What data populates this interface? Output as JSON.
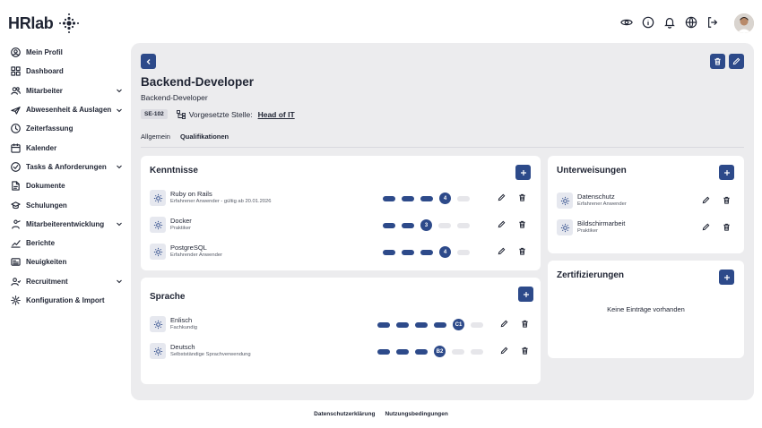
{
  "app": {
    "logo_text": "HRlab"
  },
  "sidebar": {
    "items": [
      {
        "label": "Mein Profil",
        "icon": "user-circle-icon",
        "chevron": false
      },
      {
        "label": "Dashboard",
        "icon": "grid-icon",
        "chevron": false
      },
      {
        "label": "Mitarbeiter",
        "icon": "users-icon",
        "chevron": true
      },
      {
        "label": "Abwesenheit & Auslagen",
        "icon": "plane-icon",
        "chevron": true
      },
      {
        "label": "Zeiterfassung",
        "icon": "clock-icon",
        "chevron": false
      },
      {
        "label": "Kalender",
        "icon": "calendar-icon",
        "chevron": false
      },
      {
        "label": "Tasks & Anforderungen",
        "icon": "check-circle-icon",
        "chevron": true
      },
      {
        "label": "Dokumente",
        "icon": "document-icon",
        "chevron": false
      },
      {
        "label": "Schulungen",
        "icon": "graduation-icon",
        "chevron": false
      },
      {
        "label": "Mitarbeiterentwicklung",
        "icon": "development-icon",
        "chevron": true
      },
      {
        "label": "Berichte",
        "icon": "chart-icon",
        "chevron": false
      },
      {
        "label": "Neuigkeiten",
        "icon": "news-icon",
        "chevron": false
      },
      {
        "label": "Recruitment",
        "icon": "recruit-icon",
        "chevron": true
      },
      {
        "label": "Konfiguration & Import",
        "icon": "gear-icon",
        "chevron": false
      }
    ]
  },
  "header": {
    "title": "Backend-Developer",
    "subtitle": "Backend-Developer",
    "code": "SE-102",
    "supervisor_label": "Vorgesetzte Stelle:",
    "supervisor_value": "Head of IT"
  },
  "tabs": [
    {
      "label": "Allgemein",
      "active": false
    },
    {
      "label": "Qualifikationen",
      "active": true
    }
  ],
  "kenntnisse": {
    "title": "Kenntnisse",
    "items": [
      {
        "name": "Ruby on Rails",
        "sub": "Erfahrener Anwender - gültig ab 20.01.2026",
        "level": "4",
        "filled": 3,
        "total": 5
      },
      {
        "name": "Docker",
        "sub": "Praktiker",
        "level": "3",
        "filled": 2,
        "total": 5
      },
      {
        "name": "PostgreSQL",
        "sub": "Erfahrender Anwender",
        "level": "4",
        "filled": 3,
        "total": 5
      }
    ]
  },
  "sprache": {
    "title": "Sprache",
    "items": [
      {
        "name": "Enlisch",
        "sub": "Fachkundig",
        "level": "C1",
        "filled": 4,
        "total": 6
      },
      {
        "name": "Deutsch",
        "sub": "Selbstständige Sprachverwendung",
        "level": "B2",
        "filled": 3,
        "total": 6
      }
    ]
  },
  "unterweisungen": {
    "title": "Unterweisungen",
    "items": [
      {
        "name": "Datenschutz",
        "sub": "Erfahrener Anwender"
      },
      {
        "name": "Bildschirmarbeit",
        "sub": "Praktiker"
      }
    ]
  },
  "zertifizierungen": {
    "title": "Zertifizierungen",
    "empty_text": "Keine Einträge vorhanden"
  },
  "footer": {
    "privacy": "Datenschutzerklärung",
    "terms": "Nutzungsbedingungen"
  },
  "colors": {
    "accent": "#2d4a8a",
    "panel": "#ececee",
    "empty_bar": "#e6e6ea"
  }
}
